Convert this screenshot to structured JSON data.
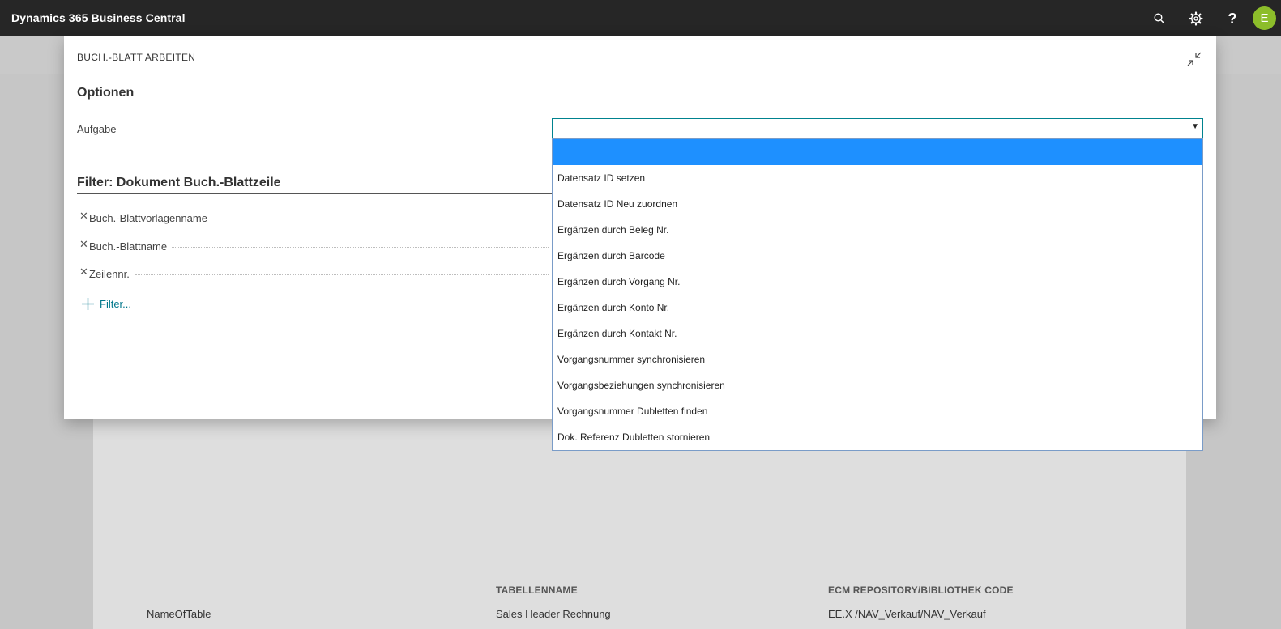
{
  "app": {
    "title": "Dynamics 365 Business Central",
    "user_initial": "E"
  },
  "colors": {
    "accent": "#00838f",
    "avatar": "#8cbd2a",
    "selected_option": "#1e90ff",
    "topbar": "#262626"
  },
  "icons": {
    "search": "search-icon",
    "settings": "gear-icon",
    "help": "question-icon",
    "collapse": "collapse-icon",
    "remove": "close-icon",
    "add": "plus-icon"
  },
  "dialog": {
    "title": "BUCH.-BLATT ARBEITEN",
    "options_section": {
      "title": "Optionen",
      "task_label": "Aufgabe",
      "task_value": "",
      "task_options": [
        "",
        "Datensatz ID setzen",
        "Datensatz ID Neu zuordnen",
        "Ergänzen durch Beleg Nr.",
        "Ergänzen durch Barcode",
        "Ergänzen durch Vorgang Nr.",
        "Ergänzen durch Konto Nr.",
        "Ergänzen durch Kontakt Nr.",
        "Vorgangsnummer synchronisieren",
        "Vorgangsbeziehungen synchronisieren",
        "Vorgangsnummer Dubletten finden",
        "Dok. Referenz Dubletten stornieren"
      ]
    },
    "filter_section": {
      "title": "Filter: Dokument Buch.-Blattzeile",
      "filters": [
        "Buch.-Blattvorlagenname",
        "Buch.-Blattname",
        "Zeilennr."
      ],
      "add_filter_label": "Filter..."
    }
  },
  "background_page": {
    "columns": [
      "TABELLENNAME",
      "ECM REPOSITORY/BIBLIOTHEK CODE"
    ],
    "row": [
      "NameOfTable",
      "Sales Header Rechnung",
      "EE.X /NAV_Verkauf/NAV_Verkauf"
    ]
  }
}
